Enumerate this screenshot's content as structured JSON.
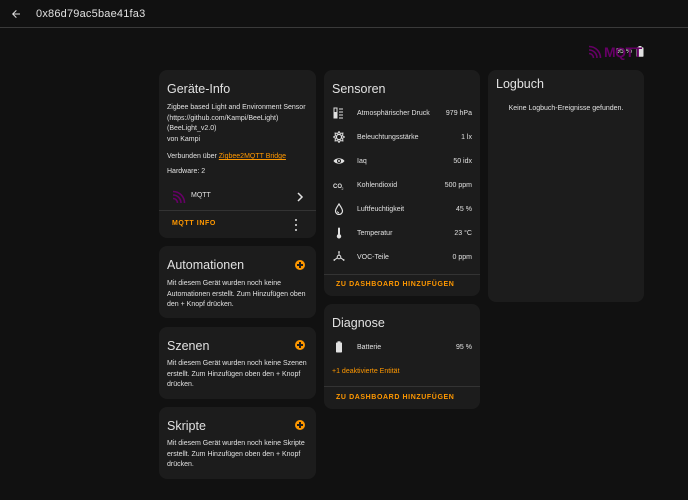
{
  "header": {
    "title": "0x86d79ac5bae41fa3"
  },
  "status": {
    "battery": "95 %"
  },
  "device_info": {
    "title": "Geräte-Info",
    "description_1": "Zigbee based Light and Environment Sensor",
    "description_2": "(https://github.com/Kampi/BeeLight)",
    "description_3": "(BeeLight_v2.0)",
    "vendor": "von Kampi",
    "connected_prefix": "Verbunden über",
    "bridge_link": "Zigbee2MQTT Bridge",
    "hardware": "Hardware: 2",
    "integration": "MQTT",
    "action": "MQTT INFO"
  },
  "automations": {
    "title": "Automationen",
    "text": "Mit diesem Gerät wurden noch keine Automationen erstellt. Zum Hinzufügen oben den + Knopf drücken."
  },
  "scenes": {
    "title": "Szenen",
    "text": "Mit diesem Gerät wurden noch keine Szenen erstellt. Zum Hinzufügen oben den + Knopf drücken."
  },
  "scripts": {
    "title": "Skripte",
    "text": "Mit diesem Gerät wurden noch keine Skripte erstellt. Zum Hinzufügen oben den + Knopf drücken."
  },
  "sensors": {
    "title": "Sensoren",
    "rows": [
      {
        "icon": "gauge-icon",
        "name": "Atmosphärischer Druck",
        "value": "979 hPa"
      },
      {
        "icon": "brightness-icon",
        "name": "Beleuchtungsstärke",
        "value": "1 lx"
      },
      {
        "icon": "eye-icon",
        "name": "Iaq",
        "value": "50 idx"
      },
      {
        "icon": "co2-icon",
        "name": "Kohlendioxid",
        "value": "500 ppm"
      },
      {
        "icon": "water-drop-icon",
        "name": "Luftfeuchtigkeit",
        "value": "45 %"
      },
      {
        "icon": "thermometer-icon",
        "name": "Temperatur",
        "value": "23 °C"
      },
      {
        "icon": "molecule-icon",
        "name": "VOC-Teile",
        "value": "0 ppm"
      }
    ],
    "action": "ZU DASHBOARD HINZUFÜGEN"
  },
  "diagnostics": {
    "title": "Diagnose",
    "battery_name": "Batterie",
    "battery_value": "95 %",
    "disabled_entities": "+1 deaktivierte Entität",
    "action": "ZU DASHBOARD HINZUFÜGEN"
  },
  "logbook": {
    "title": "Logbuch",
    "empty": "Keine Logbuch-Ereignisse gefunden."
  },
  "colors": {
    "accent": "#ff9800",
    "mqtt_brand": "#660066",
    "card": "#1c1c1c",
    "background": "#111111"
  }
}
